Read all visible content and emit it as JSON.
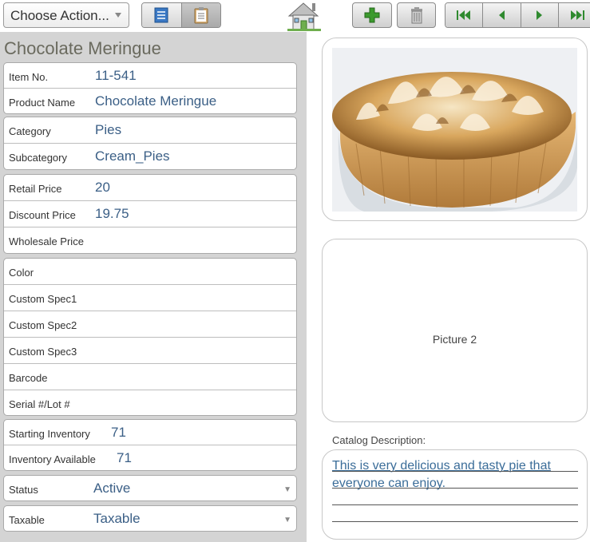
{
  "toolbar": {
    "choose_action": "Choose Action...",
    "icons": {
      "list_view": "list-view-icon",
      "form_view": "clipboard-icon",
      "home": "home-icon",
      "add": "plus-icon",
      "delete": "trash-icon",
      "first": "first-record-icon",
      "prev": "previous-record-icon",
      "next": "next-record-icon",
      "last": "last-record-icon"
    }
  },
  "record": {
    "title": "Chocolate Meringue",
    "fields": {
      "item_no": {
        "label": "Item No.",
        "value": "11-541"
      },
      "product_name": {
        "label": "Product Name",
        "value": "Chocolate Meringue"
      },
      "category": {
        "label": "Category",
        "value": "Pies"
      },
      "subcategory": {
        "label": "Subcategory",
        "value": "Cream_Pies"
      },
      "retail_price": {
        "label": "Retail Price",
        "value": "20"
      },
      "discount_price": {
        "label": "Discount Price",
        "value": "19.75"
      },
      "wholesale_price": {
        "label": "Wholesale Price",
        "value": ""
      },
      "color": {
        "label": "Color",
        "value": ""
      },
      "custom_spec1": {
        "label": "Custom Spec1",
        "value": ""
      },
      "custom_spec2": {
        "label": "Custom Spec2",
        "value": ""
      },
      "custom_spec3": {
        "label": "Custom Spec3",
        "value": ""
      },
      "barcode": {
        "label": "Barcode",
        "value": ""
      },
      "serial_lot": {
        "label": "Serial #/Lot #",
        "value": ""
      },
      "starting_inventory": {
        "label": "Starting Inventory",
        "value": "71"
      },
      "inventory_available": {
        "label": "Inventory Available",
        "value": "71"
      },
      "status": {
        "label": "Status",
        "value": "Active"
      },
      "taxable": {
        "label": "Taxable",
        "value": "Taxable"
      }
    }
  },
  "pictures": {
    "picture2_label": "Picture 2"
  },
  "catalog": {
    "label": "Catalog Description:",
    "text": "This is very delicious and tasty pie that everyone can enjoy."
  },
  "colors": {
    "value_text": "#3b5f86",
    "panel_bg": "#d4d4d4",
    "add_green": "#3c9a2e"
  }
}
